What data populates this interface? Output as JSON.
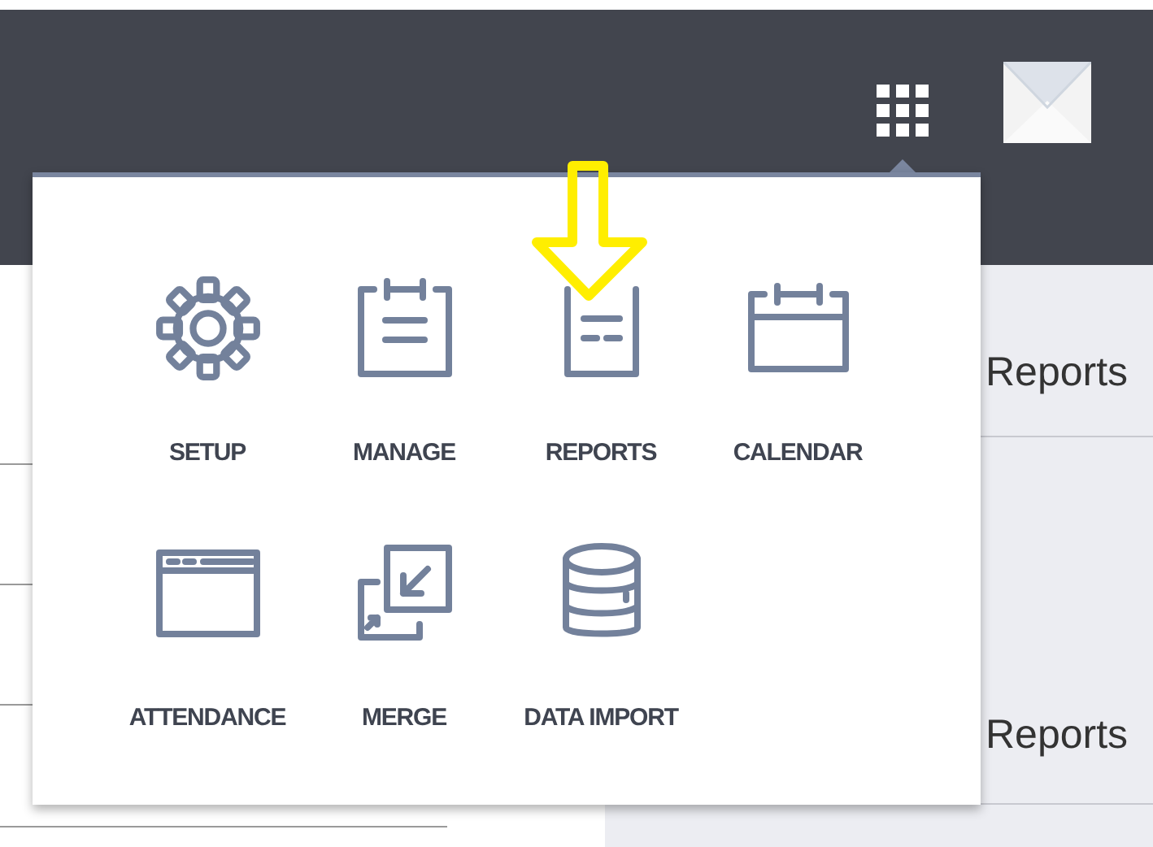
{
  "background": {
    "headings": [
      "Reports",
      "Reports"
    ]
  },
  "apps_menu": {
    "items": [
      {
        "label": "SETUP",
        "kind": "gear"
      },
      {
        "label": "MANAGE",
        "kind": "clipboard"
      },
      {
        "label": "REPORTS",
        "kind": "report"
      },
      {
        "label": "CALENDAR",
        "kind": "calendar"
      },
      {
        "label": "ATTENDANCE",
        "kind": "window"
      },
      {
        "label": "MERGE",
        "kind": "merge"
      },
      {
        "label": "DATA IMPORT",
        "kind": "database"
      }
    ]
  },
  "annotation": {
    "kind": "down-arrow"
  }
}
